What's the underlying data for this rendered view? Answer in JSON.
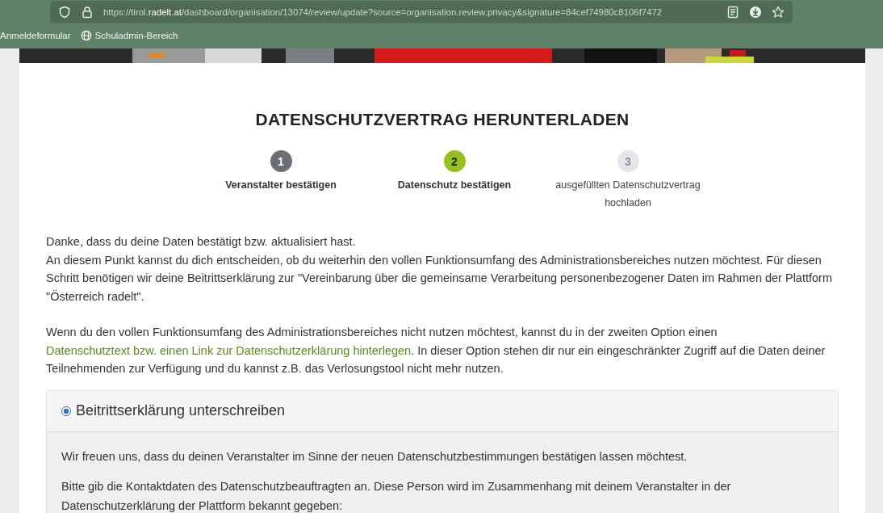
{
  "browser": {
    "url": "https://tirol.**radelt.at**/dashboard/organisation/13074/review/update?source=organisation.review.privacy&signature=84cef74980c8106f7472",
    "bookmarks": [
      {
        "label": "Anmeldeformular",
        "kind": "plain"
      },
      {
        "label": "Schuladmin-Bereich",
        "kind": "globe"
      }
    ]
  },
  "page": {
    "title": "DATENSCHUTZVERTRAG HERUNTERLADEN",
    "steps": [
      {
        "number": "1",
        "label": "Veranstalter bestätigen",
        "completed": true,
        "selected": false
      },
      {
        "number": "2",
        "label": "Datenschutz bestätigen",
        "completed": false,
        "selected": true
      },
      {
        "number": "3",
        "label": "ausgefüllten Datenschutzvertrag hochladen",
        "completed": false,
        "selected": false
      }
    ],
    "intro": [
      "Danke, dass du deine Daten bestätigt bzw. aktualisiert hast.",
      "An diesem Punkt kannst du dich entscheiden, ob du weiterhin den vollen Funktionsumfang des Administrationsbereiches nutzen möchtest. Für diesen Schritt benötigen wir deine Beitrittserklärung zur \"Vereinbarung über die gemeinsame Verarbeitung personenbezogener Daten im Rahmen der Plattform \"Österreich radelt\"."
    ],
    "option_note": {
      "before": "Wenn du den vollen Funktionsumfang des Administrationsbereiches nicht nutzen möchtest, kannst du in der zweiten Option einen",
      "link": "Datenschutztext bzw. einen Link zur Datenschutzerklärung hinterlegen",
      "after": ". In dieser Option stehen dir nur ein eingeschränkter Zugriff auf die Daten deiner Teilnehmenden zur Verfügung und du kannst z.B. das Verlosungstool nicht mehr nutzen."
    },
    "option": {
      "label": "Beitrittserklärung unterschreiben",
      "selected": true,
      "paragraphs": [
        "Wir freuen uns, dass du deinen Veranstalter im Sinne der neuen Datenschutzbestimmungen bestätigen lassen möchtest.",
        "Bitte gib die Kontaktdaten des Datenschutzbeauftragten an. Diese Person wird im Zusammenhang mit deinem Veranstalter in der Datenschutzerklärung der Plattform bekannt gegeben:"
      ]
    }
  }
}
